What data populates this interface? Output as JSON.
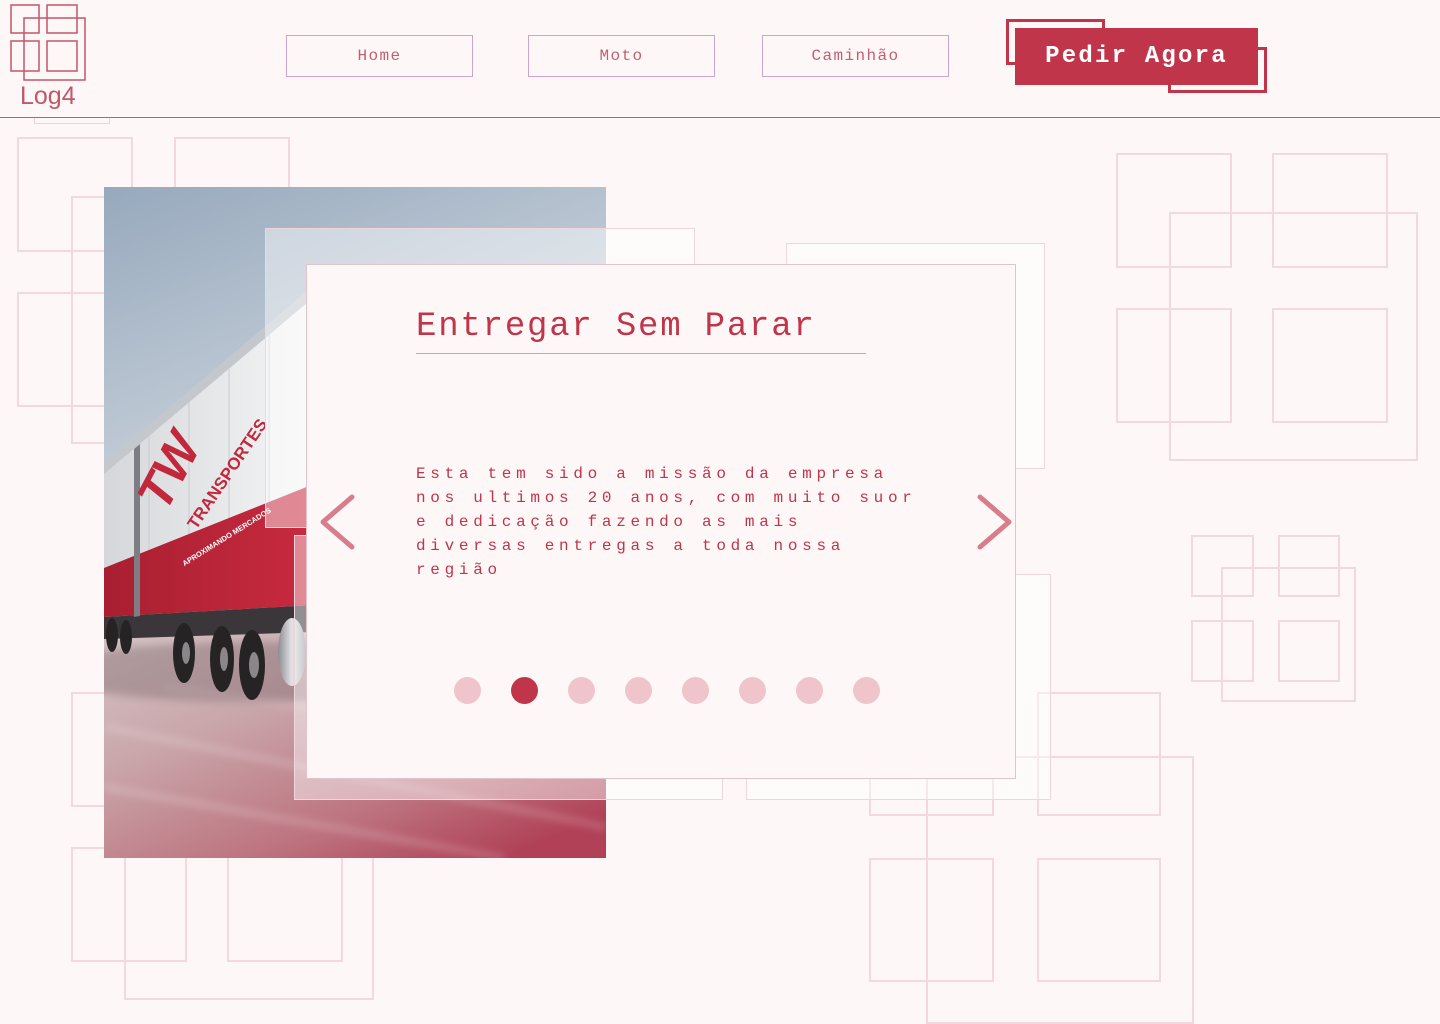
{
  "brand": {
    "name": "Log4",
    "logo_icon": "squares-logo-icon"
  },
  "nav": {
    "items": [
      {
        "label": "Home"
      },
      {
        "label": "Moto"
      },
      {
        "label": "Caminhão"
      }
    ]
  },
  "cta": {
    "label": "Pedir Agora"
  },
  "hero": {
    "truck_lettering": {
      "mark": "TW",
      "name": "TRANSPORTES",
      "slogan": "APROXIMANDO MERCADOS"
    }
  },
  "slider": {
    "title": "Entregar Sem Parar",
    "text": "Esta tem sido a missão da empresa nos ultimos 20 anos, com muito suor e dedicação fazendo as mais diversas entregas a toda nossa região",
    "prev_icon": "chevron-left-icon",
    "next_icon": "chevron-right-icon",
    "dots": [
      {
        "active": false
      },
      {
        "active": true
      },
      {
        "active": false
      },
      {
        "active": false
      },
      {
        "active": false
      },
      {
        "active": false
      },
      {
        "active": false
      },
      {
        "active": false
      }
    ]
  },
  "colors": {
    "background": "#fdf8f7",
    "accent": "#c0354a",
    "accent_light": "#d97c8c",
    "nav_text": "#c45f72",
    "nav_border": "#cfa4c6",
    "dot_inactive": "#efc4cb",
    "decor": "#f3d8df"
  }
}
